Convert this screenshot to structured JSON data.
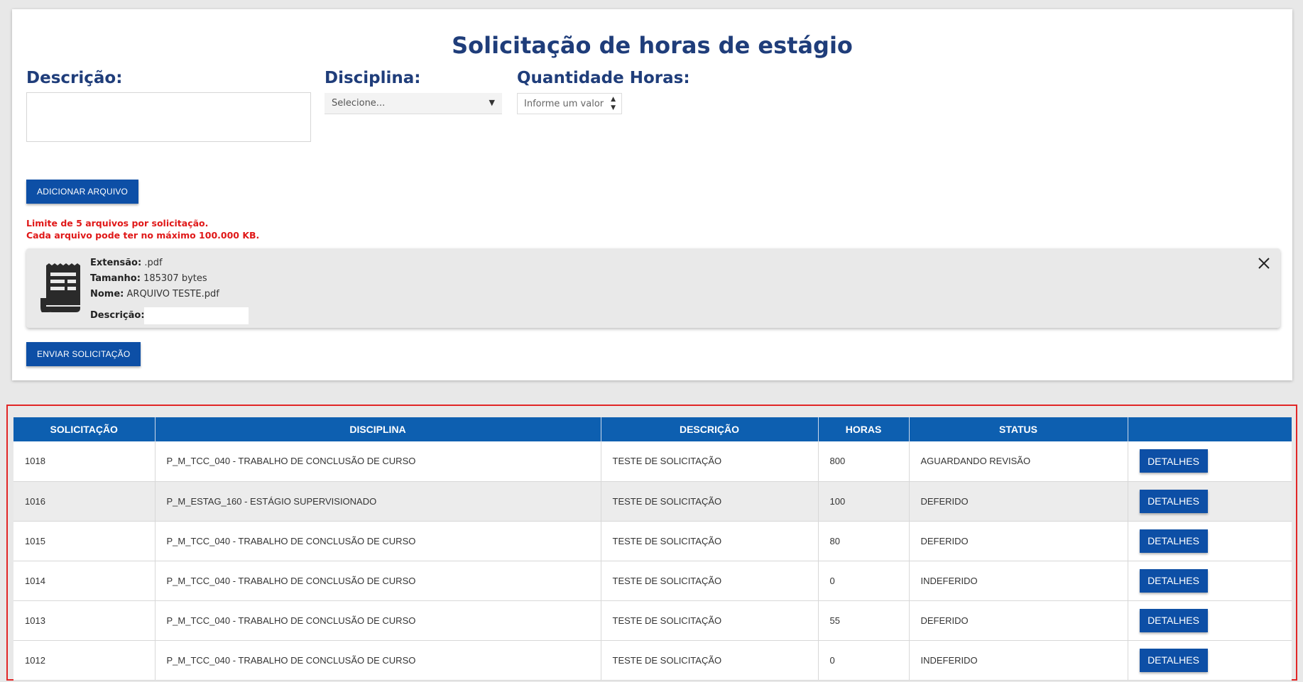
{
  "form": {
    "title": "Solicitação de horas de estágio",
    "description_label": "Descrição:",
    "discipline_label": "Disciplina:",
    "discipline_selected": "Selecione...",
    "hours_label": "Quantidade Horas:",
    "hours_placeholder": "Informe um valor",
    "add_file_button": "ADICIONAR ARQUIVO",
    "limit_line_1": "Limite de 5 arquivos por solicitação.",
    "limit_line_2": "Cada arquivo pode ter no máximo 100.000 KB.",
    "submit_button": "ENVIAR SOLICITAÇÃO"
  },
  "file": {
    "icon": "document-icon",
    "extension_label": "Extensão:",
    "extension_value": ".pdf",
    "size_label": "Tamanho:",
    "size_value": "185307 bytes",
    "name_label": "Nome:",
    "name_value": "ARQUIVO TESTE.pdf",
    "description_label": "Descrição:",
    "description_value": ""
  },
  "table": {
    "headers": [
      "SOLICITAÇÃO",
      "DISCIPLINA",
      "DESCRIÇÃO",
      "HORAS",
      "STATUS",
      ""
    ],
    "details_label": "DETALHES",
    "rows": [
      {
        "id": "1018",
        "discipline": "P_M_TCC_040 - TRABALHO DE CONCLUSÃO DE CURSO",
        "description": "TESTE DE SOLICITAÇÃO",
        "hours": "800",
        "status": "AGUARDANDO REVISÃO"
      },
      {
        "id": "1016",
        "discipline": "P_M_ESTAG_160 - ESTÁGIO SUPERVISIONADO",
        "description": "TESTE DE SOLICITAÇÃO",
        "hours": "100",
        "status": "DEFERIDO"
      },
      {
        "id": "1015",
        "discipline": "P_M_TCC_040 - TRABALHO DE CONCLUSÃO DE CURSO",
        "description": "TESTE DE SOLICITAÇÃO",
        "hours": "80",
        "status": "DEFERIDO"
      },
      {
        "id": "1014",
        "discipline": "P_M_TCC_040 - TRABALHO DE CONCLUSÃO DE CURSO",
        "description": "TESTE DE SOLICITAÇÃO",
        "hours": "0",
        "status": "INDEFERIDO"
      },
      {
        "id": "1013",
        "discipline": "P_M_TCC_040 - TRABALHO DE CONCLUSÃO DE CURSO",
        "description": "TESTE DE SOLICITAÇÃO",
        "hours": "55",
        "status": "DEFERIDO"
      },
      {
        "id": "1012",
        "discipline": "P_M_TCC_040 - TRABALHO DE CONCLUSÃO DE CURSO",
        "description": "TESTE DE SOLICITAÇÃO",
        "hours": "0",
        "status": "INDEFERIDO"
      }
    ]
  },
  "colors": {
    "title": "#1f3d7a",
    "primary_button": "#0d4fa6",
    "table_header": "#0d5fb0",
    "warning_text": "#e01818",
    "highlight_border": "#e12626"
  }
}
